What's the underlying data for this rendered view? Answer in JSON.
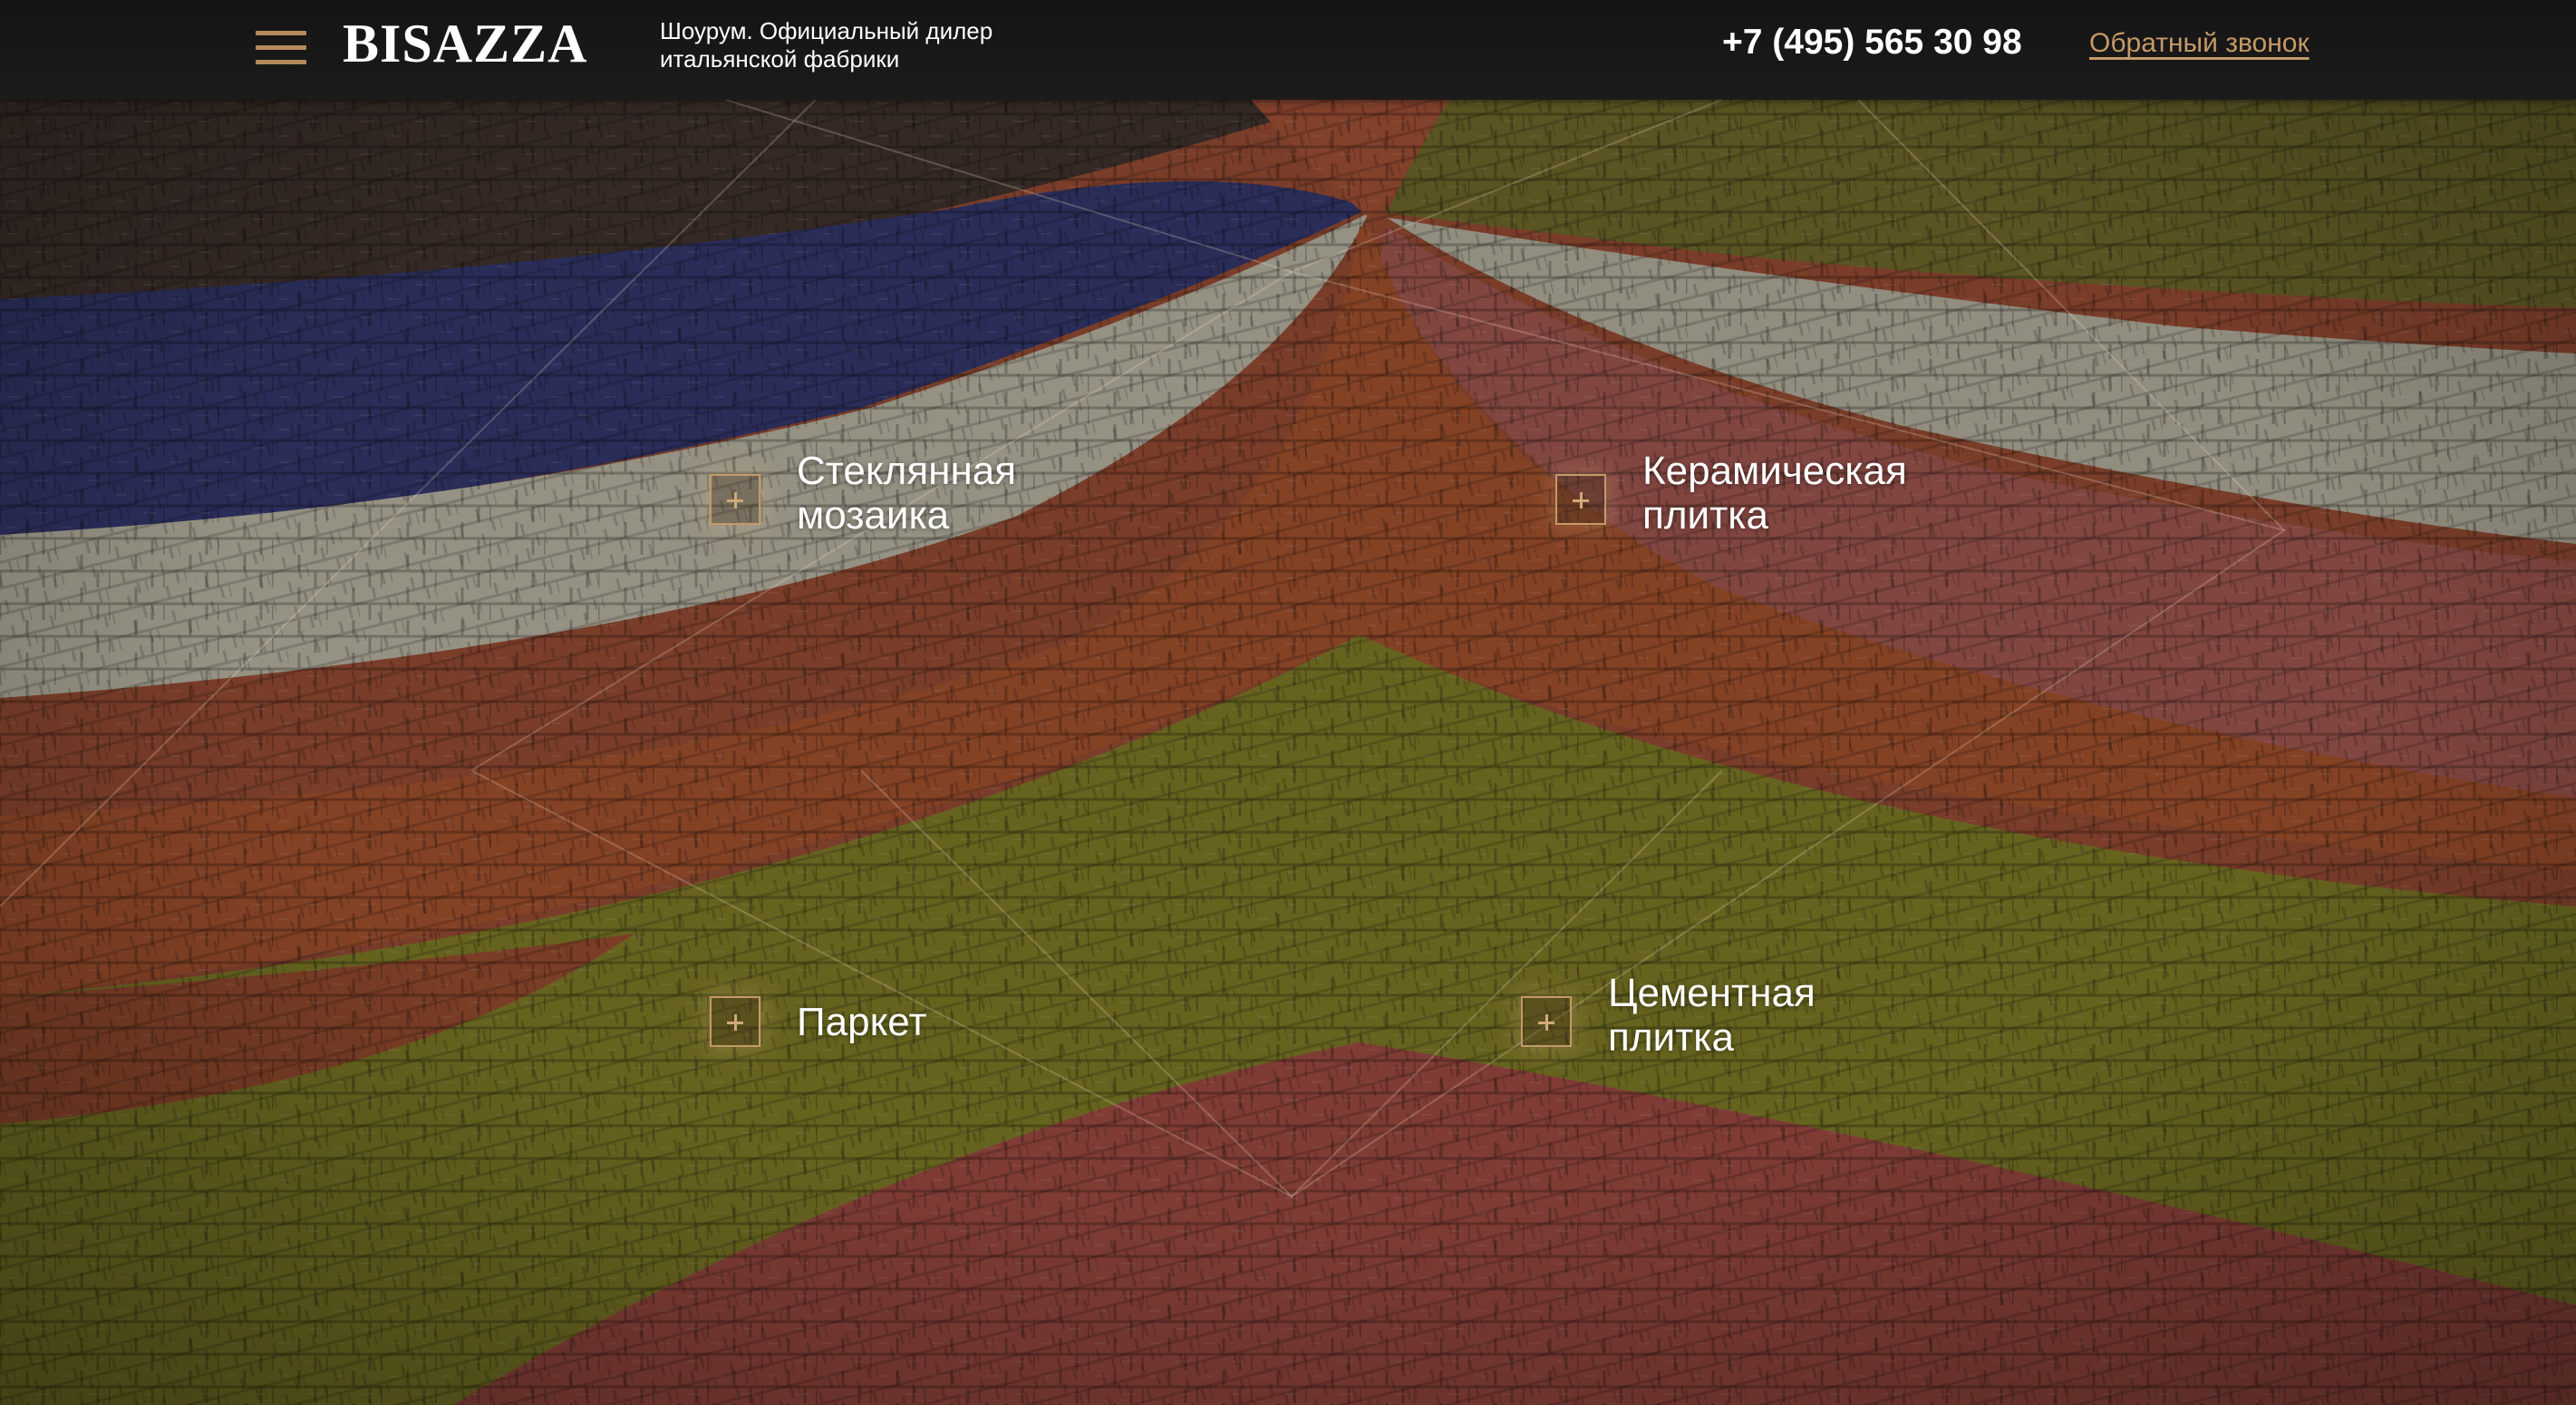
{
  "header": {
    "logo": "BISAZZA",
    "tagline_line1": "Шоурум. Официальный дилер",
    "tagline_line2": "итальянской фабрики",
    "phone": "+7 (495) 565 30 98",
    "callback_label": "Обратный звонок",
    "menu_icon": "hamburger-menu-icon"
  },
  "categories": [
    {
      "line1": "Стеклянная",
      "line2": "мозаика",
      "icon": "plus-icon"
    },
    {
      "line1": "Керамическая",
      "line2": "плитка",
      "icon": "plus-icon"
    },
    {
      "line1": "Паркет",
      "line2": "",
      "icon": "plus-icon"
    },
    {
      "line1": "Цементная",
      "line2": "плитка",
      "icon": "plus-icon"
    }
  ],
  "colors": {
    "accent": "#c39a67",
    "header_bg": "#161616",
    "text": "#ffffff"
  }
}
